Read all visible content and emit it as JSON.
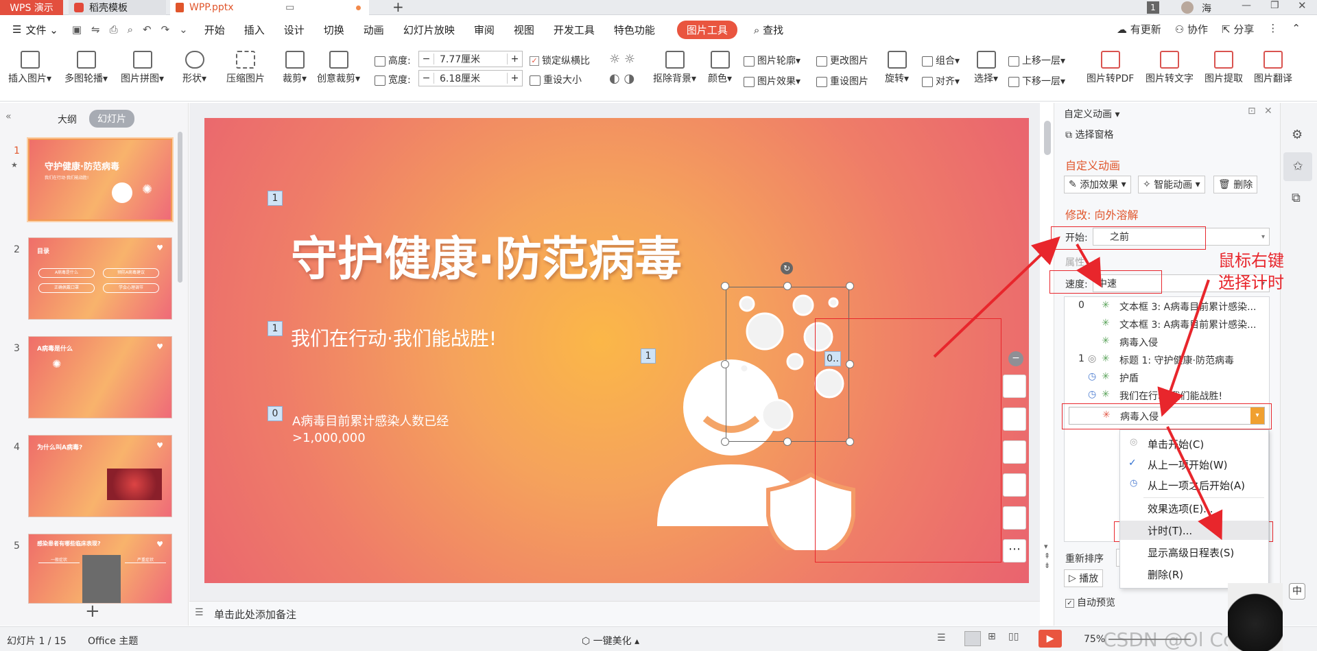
{
  "titlebar": {
    "tabs": [
      "WPS 演示",
      "稻壳模板",
      "WPP.pptx"
    ],
    "badge": "1",
    "user": "海"
  },
  "menu": {
    "file": "文件",
    "items": [
      "开始",
      "插入",
      "设计",
      "切换",
      "动画",
      "幻灯片放映",
      "审阅",
      "视图",
      "开发工具",
      "特色功能"
    ],
    "active": "图片工具",
    "search": "查找",
    "right": [
      "有更新",
      "协作",
      "分享"
    ]
  },
  "ribbon": {
    "big": [
      "插入图片",
      "多图轮播",
      "图片拼图",
      "形状",
      "压缩图片",
      "裁剪",
      "创意裁剪"
    ],
    "height_label": "高度:",
    "height_value": "7.77厘米",
    "width_label": "宽度:",
    "width_value": "6.18厘米",
    "lock": "锁定纵横比",
    "reset_size": "重设大小",
    "tools": [
      "抠除背景",
      "颜色",
      "图片轮廓",
      "更改图片",
      "图片效果",
      "重设图片",
      "旋转",
      "组合",
      "对齐",
      "选择",
      "上移一层",
      "下移一层",
      "图片转PDF",
      "图片转文字",
      "图片提取",
      "图片翻译"
    ]
  },
  "leftpanel": {
    "tab_outline": "大纲",
    "tab_slides": "幻灯片",
    "slides": [
      {
        "num": "1",
        "title": "守护健康·防范病毒",
        "sub": "我们在行动·我们能战胜!"
      },
      {
        "num": "2",
        "title": "目录",
        "items": [
          "A病毒是什么",
          "预防A病毒建议",
          "正确佩戴口罩",
          "学会心理调节"
        ]
      },
      {
        "num": "3",
        "title": "A病毒是什么"
      },
      {
        "num": "4",
        "title": "为什么叫A病毒?"
      },
      {
        "num": "5",
        "title": "感染患者有哪些临床表现?",
        "cols": [
          "一般症状",
          "严重症状"
        ]
      }
    ]
  },
  "slide": {
    "title": "守护健康·防范病毒",
    "subtitle": "我们在行动·我们能战胜!",
    "stat_line1": "A病毒目前累计感染人数已经",
    "stat_line2": ">1,000,000",
    "markers": [
      "1",
      "1",
      "1",
      "0",
      "0.."
    ]
  },
  "notes": "单击此处添加备注",
  "rightpanel": {
    "header": "自定义动画",
    "select_pane": "选择窗格",
    "section": "自定义动画",
    "add_effect": "添加效果",
    "smart": "智能动画",
    "delete": "删除",
    "modify": "修改: 向外溶解",
    "start_label": "开始:",
    "start_value": "之前",
    "property": "属性",
    "speed_label": "速度:",
    "speed_value": "中速",
    "list": [
      {
        "idx": "0",
        "text": "文本框 3: A病毒目前累计感染..."
      },
      {
        "idx": "",
        "text": "文本框 3: A病毒目前累计感染..."
      },
      {
        "idx": "",
        "text": "病毒入侵"
      },
      {
        "idx": "1",
        "text": "标题 1: 守护健康·防范病毒"
      },
      {
        "idx": "",
        "text": "护盾"
      },
      {
        "idx": "",
        "text": "我们在行动·我们能战胜!"
      },
      {
        "idx": "",
        "text": "病毒入侵"
      }
    ],
    "reorder": "重新排序",
    "play": "播放",
    "autopreview": "自动预览"
  },
  "context_menu": [
    "单击开始(C)",
    "从上一项开始(W)",
    "从上一项之后开始(A)",
    "效果选项(E)...",
    "计时(T)...",
    "显示高级日程表(S)",
    "删除(R)"
  ],
  "annotation": {
    "line1": "鼠标右键",
    "line2": "选择计时"
  },
  "status": {
    "slide_count": "幻灯片 1 / 15",
    "theme": "Office 主题",
    "beautify": "一键美化",
    "zoom": "75%",
    "watermark": "CSDN @Ol Correct"
  }
}
